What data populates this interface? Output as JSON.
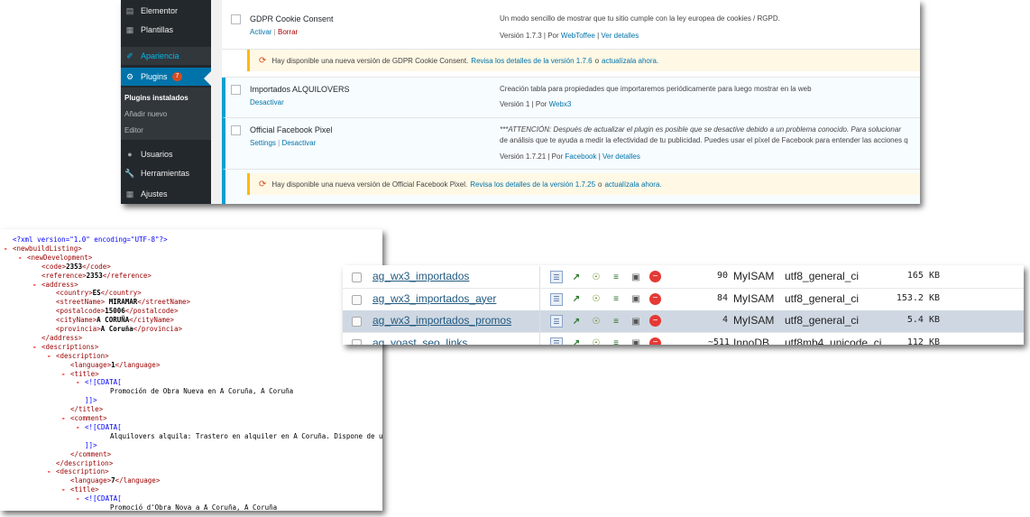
{
  "wordpress": {
    "sidebar": {
      "items": [
        {
          "label": "Elementor",
          "icon": "elementor-icon"
        },
        {
          "label": "Plantillas",
          "icon": "templates-icon"
        },
        {
          "label": "Apariencia",
          "icon": "brush-icon"
        },
        {
          "label": "Plugins",
          "icon": "plugin-icon",
          "badge": "7"
        },
        {
          "label": "Usuarios",
          "icon": "users-icon"
        },
        {
          "label": "Herramientas",
          "icon": "wrench-icon"
        },
        {
          "label": "Ajustes",
          "icon": "settings-icon"
        }
      ],
      "submenu": [
        "Plugins instalados",
        "Añadir nuevo",
        "Editor"
      ]
    },
    "plugins": [
      {
        "name": "GDPR Cookie Consent",
        "action1": "Activar",
        "action2": "Borrar",
        "description": "Un modo sencillo de mostrar que tu sitio cumple con la ley europea de cookies / RGPD.",
        "version": "Versión 1.7.3 | Por ",
        "author": "WebToffee",
        "details": "Ver detalles",
        "update": {
          "text": "Hay disponible una nueva versión de GDPR Cookie Consent.",
          "details_link": "Revisa los detalles de la versión 1.7.6",
          "or": "o",
          "update_link": "actualízala ahora."
        }
      },
      {
        "name": "Importados ALQUILOVERS",
        "action1": "Desactivar",
        "description": "Creación tabla para propiedades que importaremos periódicamente para luego mostrar en la web",
        "version": "Versión 1 | Por ",
        "author": "Webx3"
      },
      {
        "name": "Official Facebook Pixel",
        "action1": "Settings",
        "action2": "Desactivar",
        "description": "***ATTENCIÓN: Después de actualizar el plugin es posible que se desactive debido a un problema conocido. Para solucionar",
        "description2": "de análisis que te ayuda a medir la efectividad de tu publicidad. Puedes usar el píxel de Facebook para entender las acciones q",
        "version": "Versión 1.7.21 | Por ",
        "author": "Facebook",
        "details": "Ver detalles",
        "update": {
          "text": "Hay disponible una nueva versión de Official Facebook Pixel.",
          "details_link": "Revisa los detalles de la versión 1.7.25",
          "or": "o",
          "update_link": "actualízala ahora."
        }
      }
    ]
  },
  "xml": {
    "lines": [
      {
        "mk": "",
        "a": "<?xml version=\"1.0\" encoding=\"UTF-8\"?>",
        "b": "",
        "c": "",
        "k": "pi"
      },
      {
        "mk": "-",
        "a": "<newbuildListing>",
        "b": "",
        "c": "",
        "k": "tag"
      },
      {
        "mk": "-",
        "a": "<newDevelopment>",
        "b": "",
        "c": "",
        "k": "tag"
      },
      {
        "mk": "",
        "a": "<code>",
        "b": "2353",
        "c": "</code>",
        "k": "tag"
      },
      {
        "mk": "",
        "a": "<reference>",
        "b": "2353",
        "c": "</reference>",
        "k": "tag"
      },
      {
        "mk": "-",
        "a": "<address>",
        "b": "",
        "c": "",
        "k": "tag"
      },
      {
        "mk": "",
        "a": "<country>",
        "b": "ES",
        "c": "</country>",
        "k": "tag"
      },
      {
        "mk": "",
        "a": "<streetName>",
        "b": " MIRAMAR",
        "c": "</streetName>",
        "k": "tag"
      },
      {
        "mk": "",
        "a": "<postalcode>",
        "b": "15006",
        "c": "</postalcode>",
        "k": "tag"
      },
      {
        "mk": "",
        "a": "<cityName>",
        "b": "A CORUÑA",
        "c": "</cityName>",
        "k": "tag"
      },
      {
        "mk": "",
        "a": "<provincia>",
        "b": "A Coruña",
        "c": "</provincia>",
        "k": "tag"
      },
      {
        "mk": "",
        "a": "</address>",
        "b": "",
        "c": "",
        "k": "tag"
      },
      {
        "mk": "-",
        "a": "<descriptions>",
        "b": "",
        "c": "",
        "k": "tag"
      },
      {
        "mk": "-",
        "a": "<description>",
        "b": "",
        "c": "",
        "k": "tag"
      },
      {
        "mk": "",
        "a": "<language>",
        "b": "1",
        "c": "</language>",
        "k": "tag"
      },
      {
        "mk": "-",
        "a": "<title>",
        "b": "",
        "c": "",
        "k": "tag"
      },
      {
        "mk": "-",
        "a": "<![CDATA[",
        "b": "",
        "c": "",
        "k": "cdata"
      },
      {
        "mk": "",
        "a": "",
        "b": "Promoción de Obra Nueva en A Coruña, A Coruña",
        "c": "",
        "k": "text"
      },
      {
        "mk": "",
        "a": "]]>",
        "b": "",
        "c": "",
        "k": "cdata"
      },
      {
        "mk": "",
        "a": "</title>",
        "b": "",
        "c": "",
        "k": "tag"
      },
      {
        "mk": "-",
        "a": "<comment>",
        "b": "",
        "c": "",
        "k": "tag"
      },
      {
        "mk": "-",
        "a": "<![CDATA[",
        "b": "",
        "c": "",
        "k": "cdata"
      },
      {
        "mk": "",
        "a": "",
        "b": "Alquilovers alquila: Trastero en alquiler en A Coruña. Dispone de una superfic",
        "c": "",
        "k": "text"
      },
      {
        "mk": "",
        "a": "]]>",
        "b": "",
        "c": "",
        "k": "cdata"
      },
      {
        "mk": "",
        "a": "</comment>",
        "b": "",
        "c": "",
        "k": "tag"
      },
      {
        "mk": "",
        "a": "</description>",
        "b": "",
        "c": "",
        "k": "tag"
      },
      {
        "mk": "-",
        "a": "<description>",
        "b": "",
        "c": "",
        "k": "tag"
      },
      {
        "mk": "",
        "a": "<language>",
        "b": "7",
        "c": "</language>",
        "k": "tag"
      },
      {
        "mk": "-",
        "a": "<title>",
        "b": "",
        "c": "",
        "k": "tag"
      },
      {
        "mk": "-",
        "a": "<![CDATA[",
        "b": "",
        "c": "",
        "k": "cdata"
      },
      {
        "mk": "",
        "a": "",
        "b": "Promoció d'Obra Nova a A Coruña, A Coruña",
        "c": "",
        "k": "text"
      }
    ]
  },
  "phpmyadmin": {
    "tables": [
      {
        "name": "ag_wx3_importados",
        "rows": "90",
        "engine": "MyISAM",
        "collation": "utf8_general_ci",
        "size": "165 KB"
      },
      {
        "name": "ag_wx3_importados_ayer",
        "rows": "84",
        "engine": "MyISAM",
        "collation": "utf8_general_ci",
        "size": "153.2 KB"
      },
      {
        "name": "ag_wx3_importados_promos",
        "rows": "4",
        "engine": "MyISAM",
        "collation": "utf8_general_ci",
        "size": "5.4 KB"
      },
      {
        "name": "ag_yoast_seo_links",
        "rows": "~511",
        "engine": "InnoDB",
        "collation": "utf8mb4_unicode_ci",
        "size": "112 KB"
      }
    ],
    "action_icons": [
      "browse-icon",
      "structure-icon",
      "search-icon",
      "insert-icon",
      "empty-icon",
      "drop-icon"
    ]
  }
}
